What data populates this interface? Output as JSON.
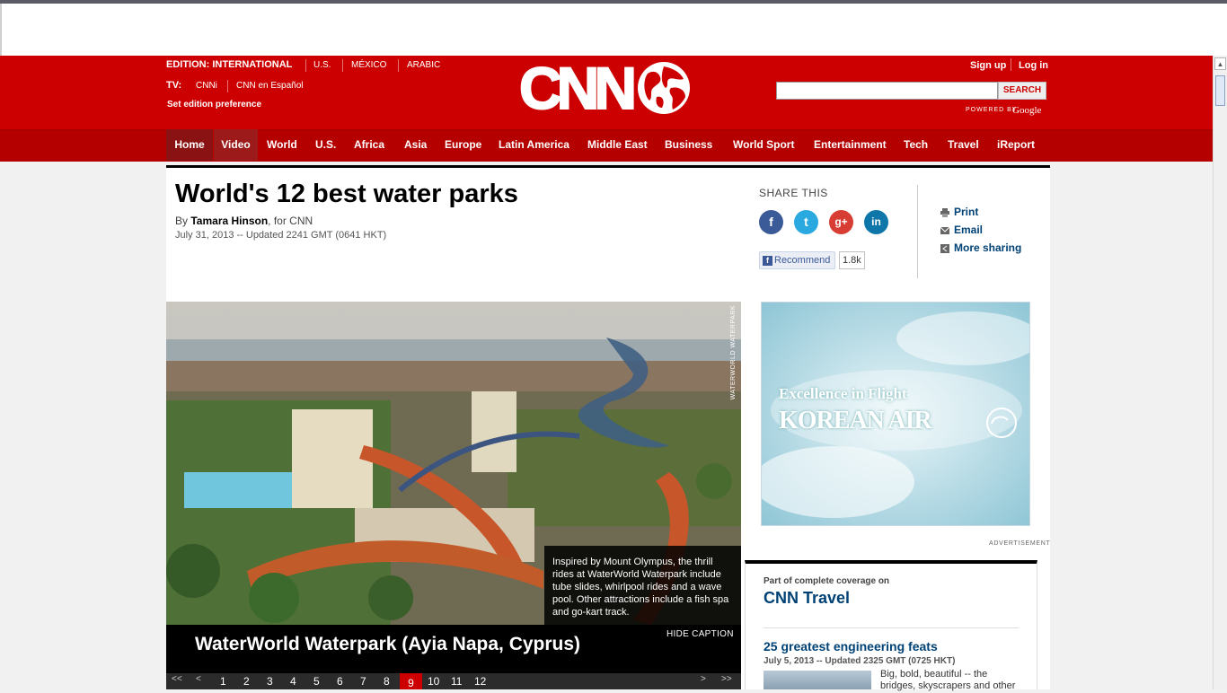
{
  "header": {
    "edition_label": "EDITION:",
    "edition_current": "INTERNATIONAL",
    "editions": [
      "U.S.",
      "MÉXICO",
      "ARABIC"
    ],
    "tv_label": "TV:",
    "tv_items": [
      "CNNi",
      "CNN en Español"
    ],
    "set_pref": "Set edition preference",
    "logo": "CNN",
    "sign_up": "Sign up",
    "log_in": "Log in",
    "search_placeholder": "",
    "search_button": "SEARCH",
    "powered_by": "POWERED BY",
    "google": "Google"
  },
  "nav": [
    "Home",
    "Video",
    "World",
    "U.S.",
    "Africa",
    "Asia",
    "Europe",
    "Latin America",
    "Middle East",
    "Business",
    "World Sport",
    "Entertainment",
    "Tech",
    "Travel",
    "iReport"
  ],
  "article": {
    "title": "World's 12 best water parks",
    "by": "By",
    "author": "Tamara Hinson",
    "author_suffix": ", for CNN",
    "date": "July 31, 2013 -- Updated 2241 GMT (0641 HKT)"
  },
  "share": {
    "title": "SHARE THIS",
    "recommend": "Recommend",
    "count": "1.8k",
    "print": "Print",
    "email": "Email",
    "more": "More sharing"
  },
  "gallery": {
    "credit": "WATERWORLD WATERPARK",
    "caption": "Inspired by Mount Olympus, the thrill rides at WaterWorld Waterpark include tube slides, whirlpool rides and a wave pool. Other attractions include a fish spa and go-kart track.",
    "title": "WaterWorld Waterpark (Ayia Napa, Cyprus)",
    "hide_caption": "HIDE CAPTION",
    "pages": [
      "1",
      "2",
      "3",
      "4",
      "5",
      "6",
      "7",
      "8",
      "9",
      "10",
      "11",
      "12"
    ],
    "current_page": "9",
    "prev": "<",
    "next": ">"
  },
  "ad": {
    "tagline": "Excellence in Flight",
    "brand": "KOREAN AIR",
    "label": "ADVERTISEMENT"
  },
  "coverage": {
    "small": "Part of complete coverage on",
    "title": "CNN Travel",
    "story_title": "25 greatest engineering feats",
    "story_date": "July 5, 2013 -- Updated 2325 GMT (0725 HKT)",
    "story_text": "Big, bold, beautiful -- the bridges, skyscrapers and other"
  },
  "colors": {
    "brand_red": "#cc0000",
    "link_blue": "#004276"
  }
}
